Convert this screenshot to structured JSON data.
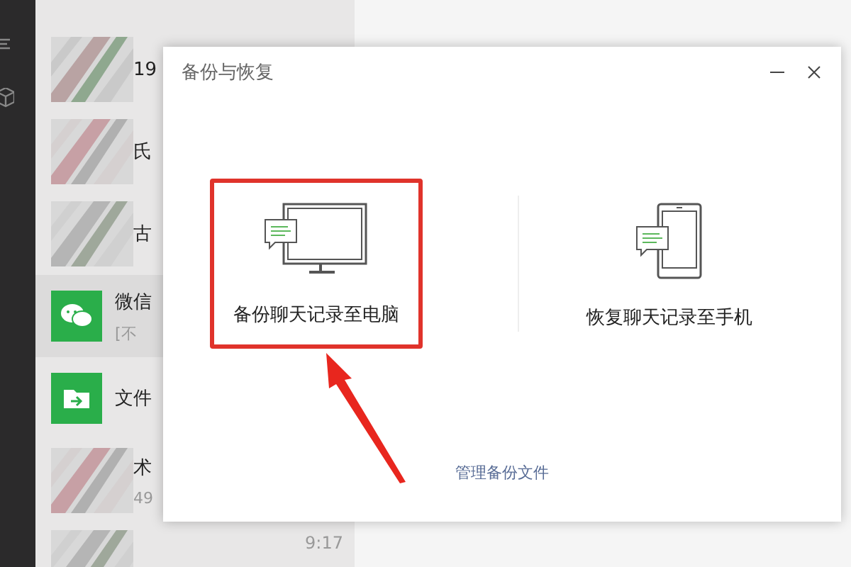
{
  "chats": [
    {
      "kind": "contact",
      "name": "19",
      "selected": false
    },
    {
      "kind": "contact",
      "name": "氏",
      "selected": false
    },
    {
      "kind": "contact",
      "name": "古",
      "selected": false
    },
    {
      "kind": "chat-app",
      "name": "微信",
      "preview": "[不",
      "selected": true
    },
    {
      "kind": "file-app",
      "name": "文件",
      "selected": false
    },
    {
      "kind": "contact",
      "name": "术",
      "preview": "49",
      "selected": false
    },
    {
      "kind": "contact",
      "time": "9:17",
      "selected": false
    }
  ],
  "dialog": {
    "title": "备份与恢复",
    "options": [
      {
        "kind": "computer",
        "label": "备份聊天记录至电脑",
        "highlighted": true
      },
      {
        "kind": "phone",
        "label": "恢复聊天记录至手机",
        "highlighted": false
      }
    ],
    "link": "管理备份文件"
  }
}
